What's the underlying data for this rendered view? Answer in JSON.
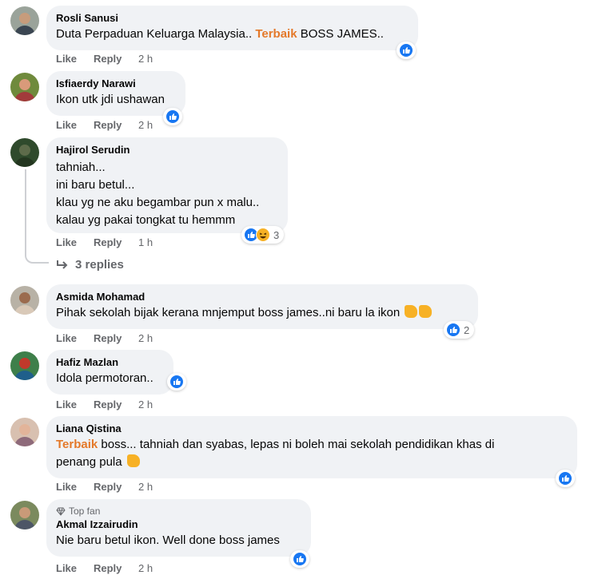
{
  "comments": [
    {
      "author": "Rosli Sanusi",
      "text_pre": "Duta Perpaduan Keluarga Malaysia.. ",
      "highlight": "Terbaik",
      "text_post": " BOSS JAMES..",
      "like": "Like",
      "reply": "Reply",
      "time": "2 h"
    },
    {
      "author": "Isfiaerdy Narawi",
      "text": "Ikon utk jdi ushawan",
      "like": "Like",
      "reply": "Reply",
      "time": "2 h"
    },
    {
      "author": "Hajirol Serudin",
      "lines": [
        "tahniah...",
        "ini baru betul...",
        "klau yg ne aku begambar pun x malu..",
        "kalau yg pakai tongkat tu hemmm"
      ],
      "like": "Like",
      "reply": "Reply",
      "time": "1 h",
      "reaction_count": "3",
      "replies_label": "3 replies"
    },
    {
      "author": "Asmida Mohamad",
      "text": "Pihak sekolah bijak kerana mnjemput boss james..ni baru la ikon",
      "like": "Like",
      "reply": "Reply",
      "time": "2 h",
      "reaction_count": "2"
    },
    {
      "author": "Hafiz Mazlan",
      "text": "Idola permotoran..",
      "like": "Like",
      "reply": "Reply",
      "time": "2 h"
    },
    {
      "author": "Liana Qistina",
      "highlight": "Terbaik",
      "text_post": " boss... tahniah dan syabas, lepas ni boleh mai sekolah pendidikan khas di",
      "line2": "penang pula",
      "like": "Like",
      "reply": "Reply",
      "time": "2 h"
    },
    {
      "badge": "Top fan",
      "author": "Akmal Izzairudin",
      "text": "Nie baru betul ikon. Well done boss james",
      "like": "Like",
      "reply": "Reply",
      "time": "2 h"
    }
  ],
  "colors": {
    "like_blue": "#1877f2",
    "highlight_orange": "#e4792a",
    "bubble_bg": "#f0f2f5",
    "meta_gray": "#65676b"
  },
  "icons": {
    "like": "thumbs-up-icon",
    "haha": "laughing-face-icon",
    "replies": "reply-arrow-icon",
    "top_fan": "diamond-icon"
  }
}
